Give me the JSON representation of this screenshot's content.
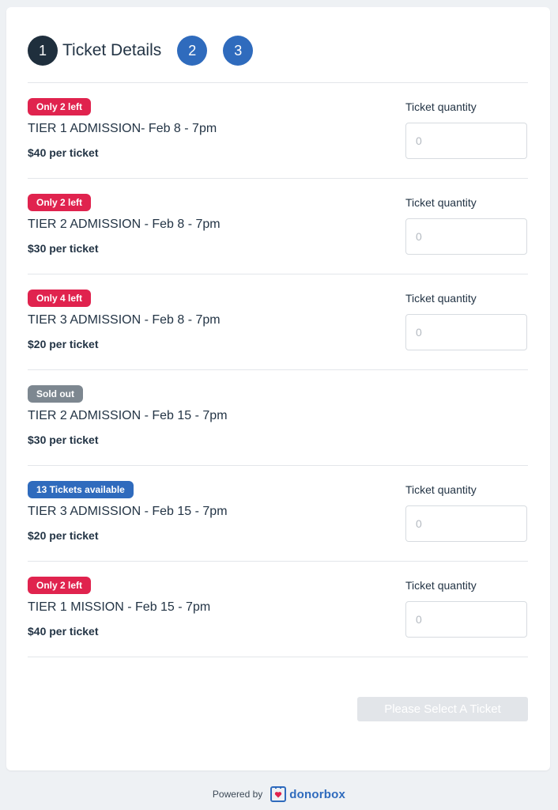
{
  "steps": [
    {
      "number": "1",
      "title": "Ticket Details"
    },
    {
      "number": "2"
    },
    {
      "number": "3"
    }
  ],
  "tickets": [
    {
      "badge": "Only 2 left",
      "badge_color": "#e0234e",
      "name": "TIER 1 ADMISSION- Feb 8 - 7pm",
      "price": "$40 per ticket",
      "quantity_label": "Ticket quantity",
      "quantity_placeholder": "0"
    },
    {
      "badge": "Only 2 left",
      "badge_color": "#e0234e",
      "name": "TIER 2 ADMISSION - Feb 8 - 7pm",
      "price": "$30 per ticket",
      "quantity_label": "Ticket quantity",
      "quantity_placeholder": "0"
    },
    {
      "badge": "Only 4 left",
      "badge_color": "#e0234e",
      "name": "TIER 3 ADMISSION - Feb 8 - 7pm",
      "price": "$20 per ticket",
      "quantity_label": "Ticket quantity",
      "quantity_placeholder": "0"
    },
    {
      "badge": "Sold out",
      "badge_color": "#7d8790",
      "name": "TIER 2 ADMISSION - Feb 15 - 7pm",
      "price": "$30 per ticket"
    },
    {
      "badge": "13 Tickets available",
      "badge_color": "#2f6bbd",
      "name": "TIER 3 ADMISSION - Feb 15 - 7pm",
      "price": "$20 per ticket",
      "quantity_label": "Ticket quantity",
      "quantity_placeholder": "0"
    },
    {
      "badge": "Only 2 left",
      "badge_color": "#e0234e",
      "name": "TIER 1 MISSION - Feb 15 - 7pm",
      "price": "$40 per ticket",
      "quantity_label": "Ticket quantity",
      "quantity_placeholder": "0"
    }
  ],
  "submit_label": "Please Select A Ticket",
  "footer": {
    "powered_by": "Powered by",
    "brand": "donorbox",
    "brand_icon": "donorbox-logo-icon"
  },
  "colors": {
    "accent": "#2f6bbd",
    "step_active": "#1f2f3d",
    "badge_red": "#e0234e",
    "badge_gray": "#7d8790"
  }
}
